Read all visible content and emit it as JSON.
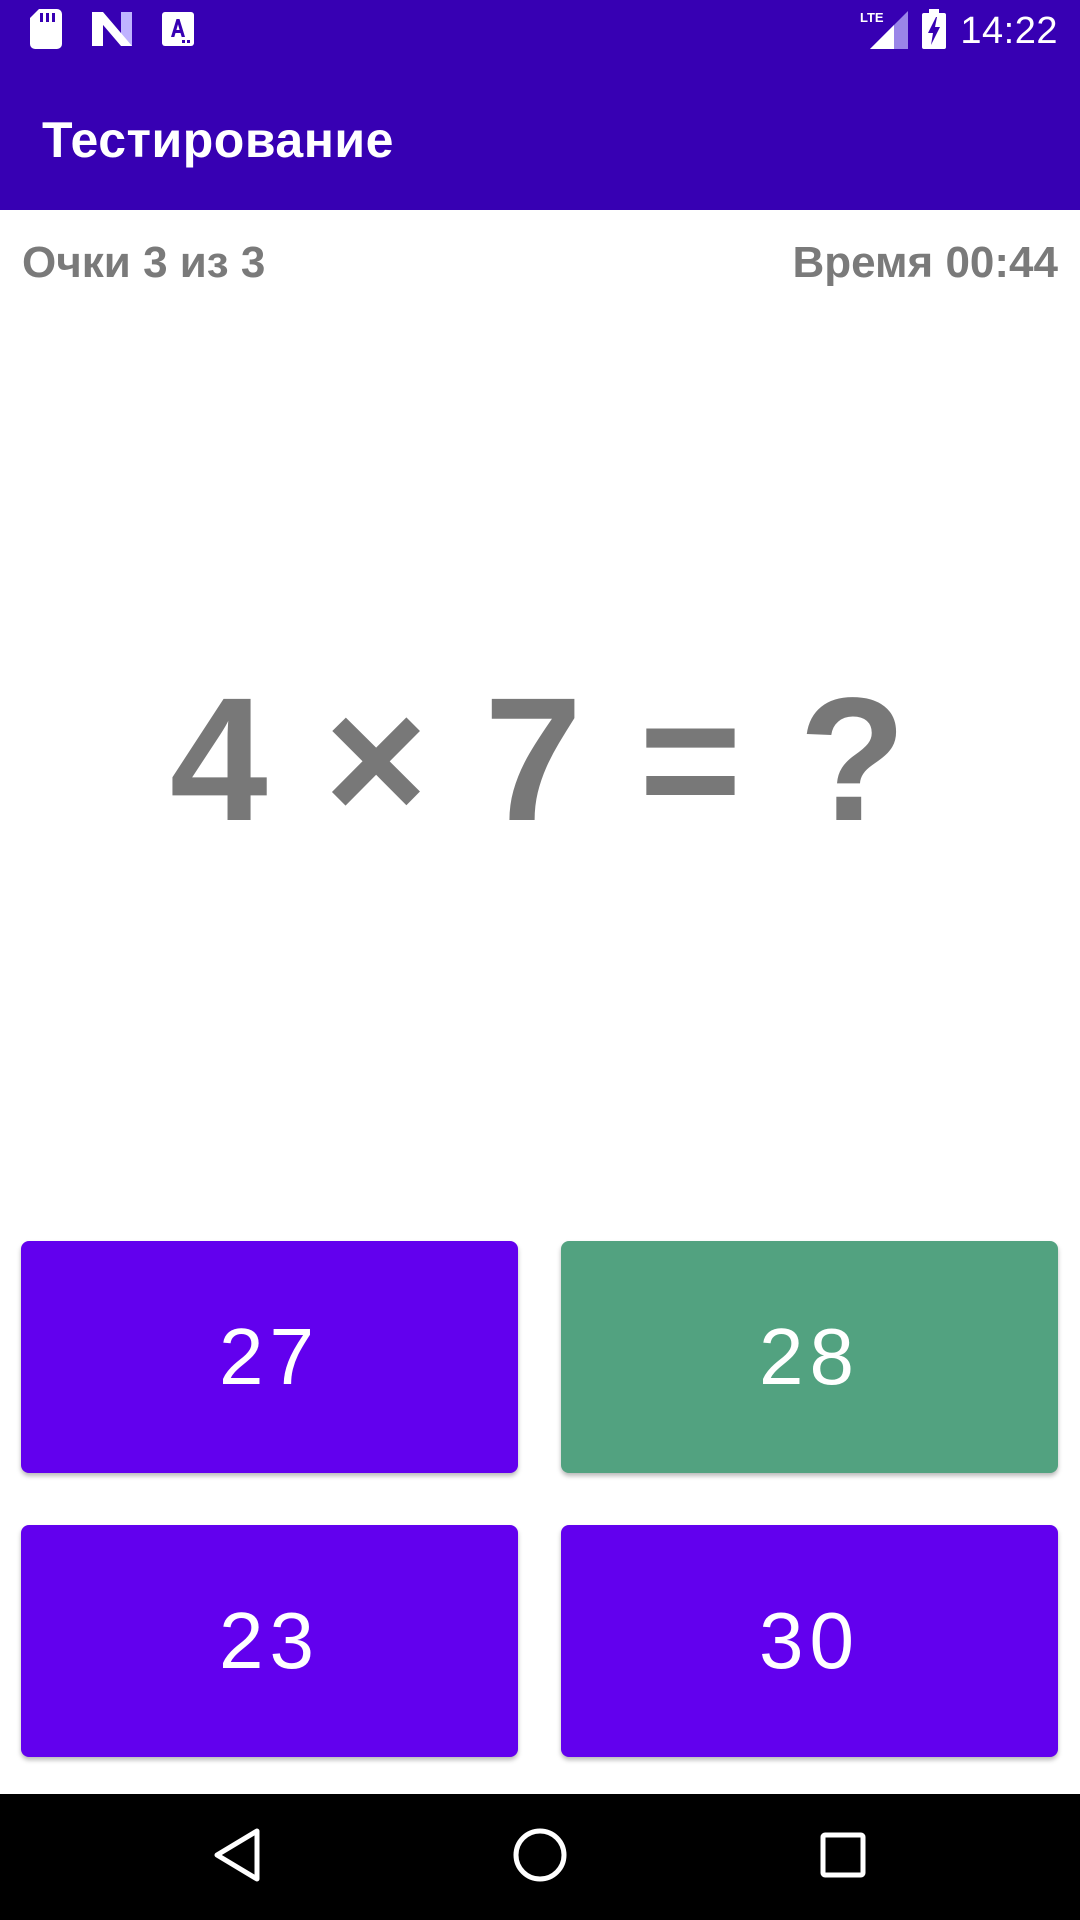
{
  "status_bar": {
    "time": "14:22",
    "network": "LTE",
    "icons": [
      "sd-card-icon",
      "n-logo-icon",
      "a-notification-icon",
      "lte-signal-icon",
      "battery-charging-icon"
    ]
  },
  "app_bar": {
    "title": "Тестирование"
  },
  "info": {
    "score": "Очки 3 из 3",
    "time": "Время 00:44"
  },
  "question": {
    "text": "4 × 7 = ?"
  },
  "answers": [
    {
      "label": "27",
      "state": "default"
    },
    {
      "label": "28",
      "state": "correct"
    },
    {
      "label": "23",
      "state": "default"
    },
    {
      "label": "30",
      "state": "default"
    }
  ],
  "colors": {
    "primary_dark": "#3700b3",
    "button": "#6200ee",
    "correct": "#52a280",
    "text_gray": "#7a7a7a"
  },
  "nav_bar": {
    "icons": [
      "back-icon",
      "home-icon",
      "recents-icon"
    ]
  }
}
